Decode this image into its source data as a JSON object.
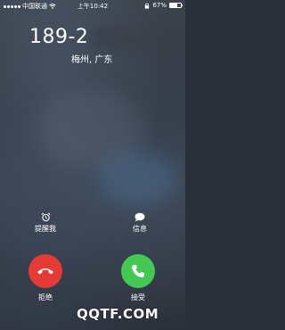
{
  "status_bar": {
    "carrier": "中国联通",
    "time": "上午10:42",
    "battery": "67%",
    "battery_fraction": 0.67
  },
  "call": {
    "number_visible": "189-2",
    "location": "梅州, 广东"
  },
  "actions": {
    "remind_label": "提醒我",
    "message_label": "信息",
    "decline_label": "拒绝",
    "accept_label": "接受"
  },
  "watermark": "QQTF.COM",
  "colors": {
    "decline": "#e53b34",
    "accept": "#45c754"
  },
  "icons": [
    "alarm-clock-icon",
    "message-bubble-icon",
    "phone-hangup-icon",
    "phone-icon",
    "wifi-icon",
    "lock-icon",
    "battery-icon"
  ]
}
